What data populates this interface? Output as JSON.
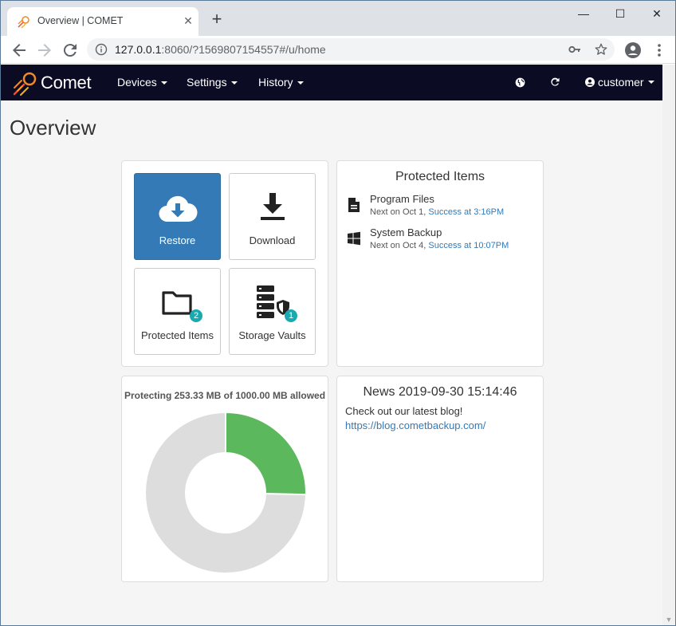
{
  "browser": {
    "tab_title": "Overview | COMET",
    "url_host": "127.0.0.1",
    "url_rest": ":8060/?1569807154557#/u/home"
  },
  "appnav": {
    "brand": "Comet",
    "devices": "Devices",
    "settings": "Settings",
    "history": "History",
    "user": "customer"
  },
  "page": {
    "title": "Overview"
  },
  "actions": {
    "restore": "Restore",
    "download": "Download",
    "protected_items": "Protected Items",
    "protected_items_count": "2",
    "storage_vaults": "Storage Vaults",
    "storage_vaults_count": "1"
  },
  "protected_items": {
    "heading": "Protected Items",
    "items": [
      {
        "name": "Program Files",
        "next": "Next on Oct 1, ",
        "status": "Success at 3:16PM",
        "icon": "file-icon"
      },
      {
        "name": "System Backup",
        "next": "Next on Oct 4, ",
        "status": "Success at 10:07PM",
        "icon": "windows-icon"
      }
    ]
  },
  "storage": {
    "caption": "Protecting 253.33 MB of 1000.00 MB allowed",
    "used_mb": 253.33,
    "total_mb": 1000.0,
    "used_color": "#5cb85c",
    "free_color": "#dddddd"
  },
  "news": {
    "heading": "News 2019-09-30 15:14:46",
    "body": "Check out our latest blog!",
    "link": "https://blog.cometbackup.com/"
  }
}
